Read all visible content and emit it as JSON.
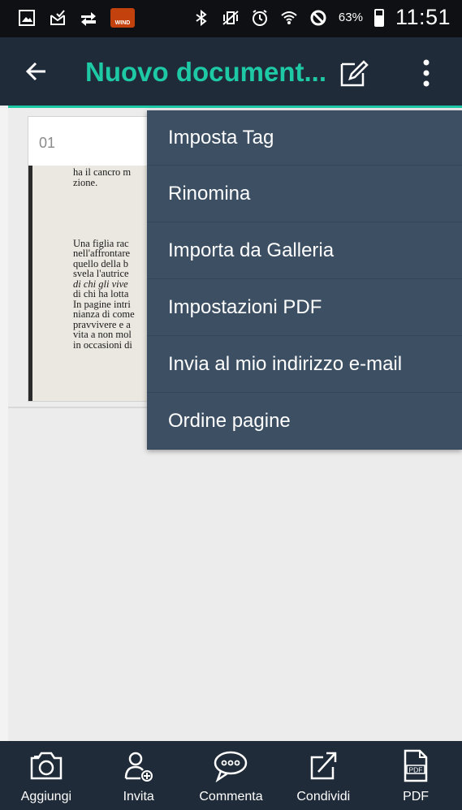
{
  "status_bar": {
    "carrier_badge": "WIND",
    "battery_pct": "63%",
    "battery_level": 0.63,
    "time": "11:51",
    "icons": [
      "gallery-icon",
      "mail-icon",
      "transfer-icon",
      "wind-logo",
      "bluetooth-icon",
      "vibrate-icon",
      "alarm-icon",
      "wifi-icon",
      "block-icon",
      "battery-icon"
    ]
  },
  "app_bar": {
    "title": "Nuovo document...",
    "icons": [
      "back-arrow-icon",
      "edit-icon",
      "more-vert-icon"
    ],
    "accent_color": "#1ec9a6",
    "bar_color": "#1f2b38"
  },
  "document": {
    "page_number": "01",
    "page_lines": [
      {
        "text": "ha il cancro m",
        "italic": false
      },
      {
        "text": "zione.",
        "italic": false
      },
      {
        "text": "",
        "italic": false
      },
      {
        "text": "",
        "italic": false
      },
      {
        "text": "",
        "italic": false
      },
      {
        "text": "",
        "italic": false
      },
      {
        "text": "",
        "italic": false
      },
      {
        "text": "Una figlia rac",
        "italic": false
      },
      {
        "text": "nell'affrontare",
        "italic": false
      },
      {
        "text": "quello della b",
        "italic": false
      },
      {
        "text": "svela l'autrice",
        "italic": false
      },
      {
        "text": "di chi gli vive",
        "italic": true
      },
      {
        "text": "di chi ha lotta",
        "italic": false
      },
      {
        "text": "In pagine intri",
        "italic": false
      },
      {
        "text": "nianza di come",
        "italic": false
      },
      {
        "text": "pravvivere e a",
        "italic": false
      },
      {
        "text": "vita a non mol",
        "italic": false
      },
      {
        "text": "in occasioni di",
        "italic": false
      }
    ]
  },
  "menu": {
    "background": "#3c4f63",
    "items": [
      "Imposta Tag",
      "Rinomina",
      "Importa da Galleria",
      "Impostazioni PDF",
      "Invia al mio indirizzo e-mail",
      "Ordine pagine"
    ]
  },
  "bottom_bar": {
    "items": [
      {
        "label": "Aggiungi",
        "icon": "camera-icon"
      },
      {
        "label": "Invita",
        "icon": "invite-user-icon"
      },
      {
        "label": "Commenta",
        "icon": "comment-icon"
      },
      {
        "label": "Condividi",
        "icon": "share-icon"
      },
      {
        "label": "PDF",
        "icon": "pdf-icon",
        "icon_text": "PDF"
      }
    ]
  }
}
